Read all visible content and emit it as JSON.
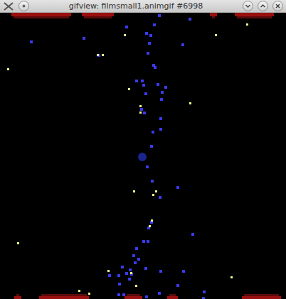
{
  "window": {
    "title": "gifview: filmsmall1.animgif #6998"
  }
}
